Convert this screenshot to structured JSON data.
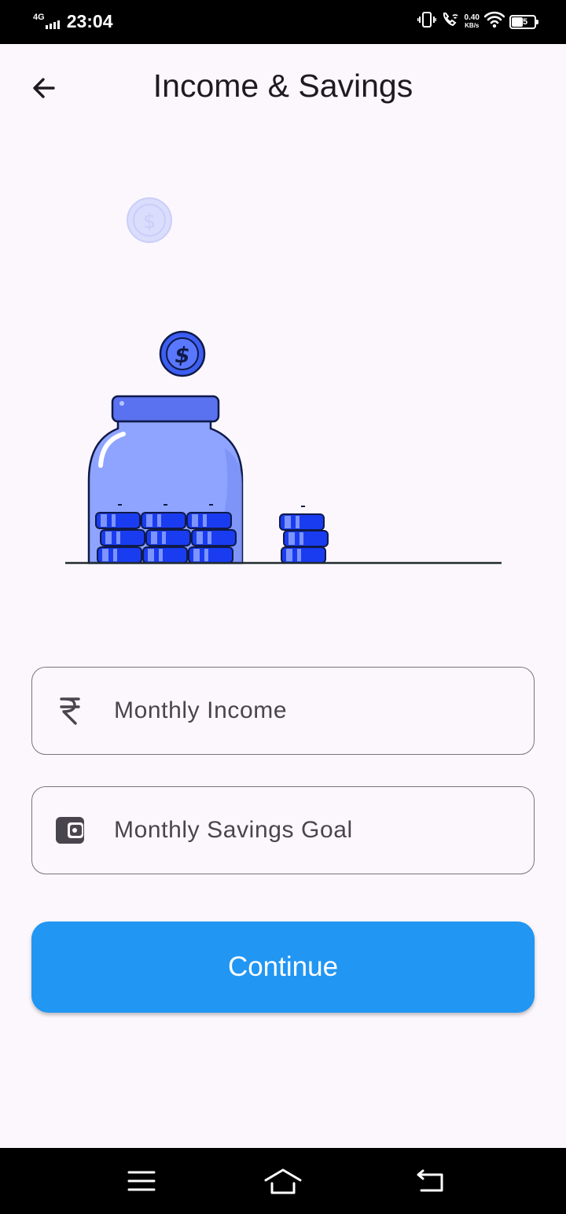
{
  "status_bar": {
    "network": "4G",
    "time": "23:04",
    "net_speed_value": "0.40",
    "net_speed_unit": "KB/s",
    "battery_level": "45"
  },
  "app_bar": {
    "title": "Income & Savings"
  },
  "form": {
    "monthly_income": {
      "placeholder": "Monthly Income",
      "value": ""
    },
    "monthly_savings_goal": {
      "placeholder": "Monthly Savings Goal",
      "value": ""
    }
  },
  "actions": {
    "continue_label": "Continue"
  },
  "colors": {
    "background": "#fcf7fc",
    "primary_button": "#2196f3",
    "jar_fill": "#8fa4ff",
    "jar_lid": "#5a72f0",
    "coin_blue": "#1a3cf0",
    "outline": "#79747e"
  },
  "icons": {
    "back": "arrow-left-icon",
    "income": "rupee-icon",
    "savings": "wallet-icon",
    "nav_menu": "menu-icon",
    "nav_home": "home-icon",
    "nav_back": "return-icon"
  }
}
